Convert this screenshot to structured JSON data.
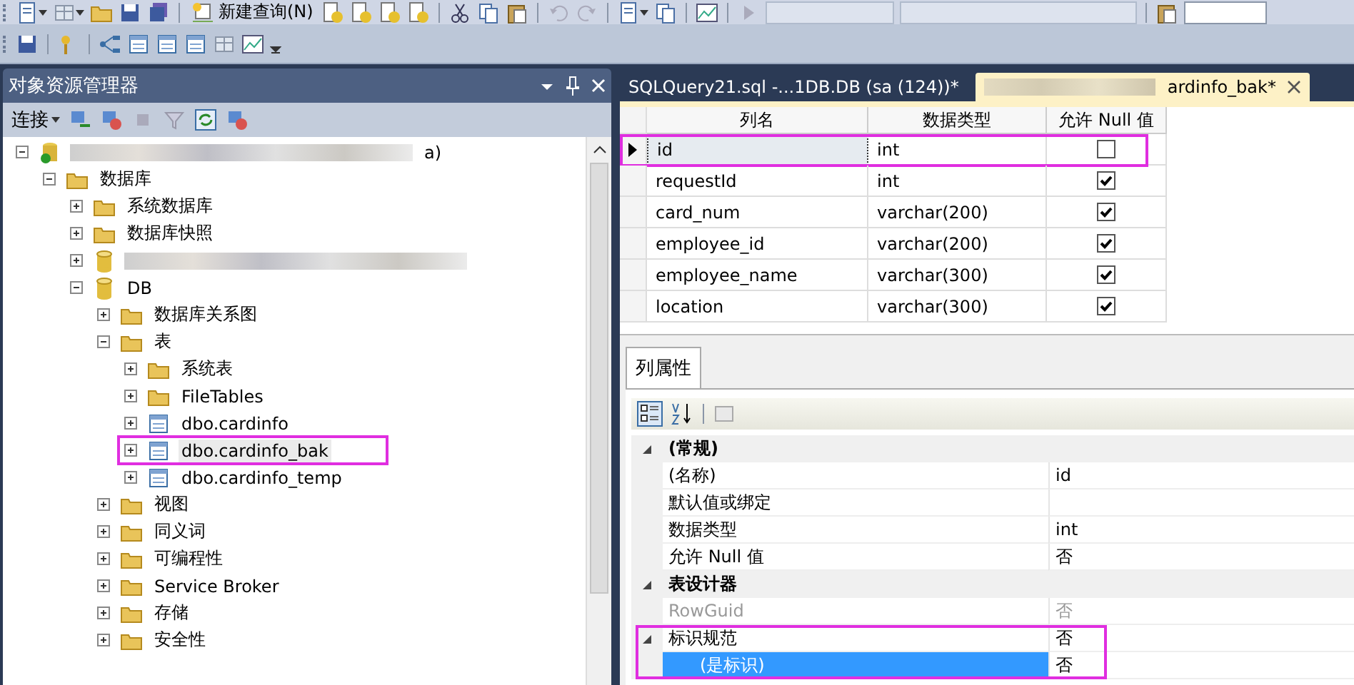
{
  "toolbar": {
    "new_query": "新建查询(N)"
  },
  "object_explorer": {
    "title": "对象资源管理器",
    "connect": "连接",
    "tree": [
      {
        "label": "a)",
        "kind": "server",
        "redacted": true,
        "expanded": true,
        "highlighted": false,
        "children": [
          {
            "label": "数据库",
            "kind": "folder",
            "expanded": true,
            "highlighted": false,
            "children": [
              {
                "label": "系统数据库",
                "kind": "folder",
                "expanded": false,
                "highlighted": false
              },
              {
                "label": "数据库快照",
                "kind": "folder",
                "expanded": false,
                "highlighted": false
              },
              {
                "kind": "database",
                "redacted": true,
                "expanded": false,
                "highlighted": false
              },
              {
                "label": "DB",
                "kind": "database",
                "expanded": true,
                "highlighted": false,
                "children": [
                  {
                    "label": "数据库关系图",
                    "kind": "folder",
                    "expanded": false,
                    "highlighted": false
                  },
                  {
                    "label": "表",
                    "kind": "folder",
                    "expanded": true,
                    "highlighted": false,
                    "children": [
                      {
                        "label": "系统表",
                        "kind": "folder",
                        "expanded": false,
                        "highlighted": false
                      },
                      {
                        "label": "FileTables",
                        "kind": "folder",
                        "expanded": false,
                        "highlighted": false
                      },
                      {
                        "label": "dbo.cardinfo",
                        "kind": "table",
                        "expanded": false,
                        "highlighted": false
                      },
                      {
                        "label": "dbo.cardinfo_bak",
                        "kind": "table",
                        "expanded": false,
                        "highlighted": true,
                        "selected": true
                      },
                      {
                        "label": "dbo.cardinfo_temp",
                        "kind": "table",
                        "expanded": false,
                        "highlighted": false
                      }
                    ]
                  },
                  {
                    "label": "视图",
                    "kind": "folder",
                    "expanded": false,
                    "highlighted": false
                  },
                  {
                    "label": "同义词",
                    "kind": "folder",
                    "expanded": false,
                    "highlighted": false
                  },
                  {
                    "label": "可编程性",
                    "kind": "folder",
                    "expanded": false,
                    "highlighted": false
                  },
                  {
                    "label": "Service Broker",
                    "kind": "folder",
                    "expanded": false,
                    "highlighted": false
                  },
                  {
                    "label": "存储",
                    "kind": "folder",
                    "expanded": false,
                    "highlighted": false
                  },
                  {
                    "label": "安全性",
                    "kind": "folder",
                    "expanded": false,
                    "highlighted": false
                  }
                ]
              }
            ]
          }
        ]
      }
    ]
  },
  "tabs": [
    {
      "label": "SQLQuery21.sql -...1DB.DB (sa (124))*",
      "selected": false,
      "redacted": false
    },
    {
      "label": "ardinfo_bak*",
      "selected": true,
      "redacted": true
    }
  ],
  "designer": {
    "columns": [
      "列名",
      "数据类型",
      "允许 Null 值"
    ],
    "rows": [
      {
        "name": "id",
        "type": "int",
        "allow_null": false,
        "selected": true,
        "highlighted": true
      },
      {
        "name": "requestId",
        "type": "int",
        "allow_null": true,
        "selected": false,
        "highlighted": false
      },
      {
        "name": "card_num",
        "type": "varchar(200)",
        "allow_null": true,
        "selected": false,
        "highlighted": false
      },
      {
        "name": "employee_id",
        "type": "varchar(200)",
        "allow_null": true,
        "selected": false,
        "highlighted": false
      },
      {
        "name": "employee_name",
        "type": "varchar(300)",
        "allow_null": true,
        "selected": false,
        "highlighted": false
      },
      {
        "name": "location",
        "type": "varchar(300)",
        "allow_null": true,
        "selected": false,
        "highlighted": false
      }
    ]
  },
  "properties": {
    "tab": "列属性",
    "rows": [
      {
        "kind": "category",
        "name": "(常规)",
        "expanded": true
      },
      {
        "kind": "property",
        "name": "(名称)",
        "value": "id",
        "disabled": false,
        "selected": false,
        "highlighted": false
      },
      {
        "kind": "property",
        "name": "默认值或绑定",
        "disabled": false,
        "selected": false,
        "highlighted": false
      },
      {
        "kind": "property",
        "name": "数据类型",
        "value": "int",
        "disabled": false,
        "selected": false,
        "highlighted": false
      },
      {
        "kind": "property",
        "name": "允许 Null 值",
        "value": "否",
        "disabled": false,
        "selected": false,
        "highlighted": false
      },
      {
        "kind": "category",
        "name": "表设计器",
        "expanded": true
      },
      {
        "kind": "property",
        "name": "RowGuid",
        "value": "否",
        "disabled": true,
        "selected": false,
        "highlighted": false
      },
      {
        "kind": "group",
        "name": "标识规范",
        "value": "否",
        "expanded": true,
        "disabled": false,
        "selected": false,
        "highlighted": true
      },
      {
        "kind": "subproperty",
        "name": "(是标识)",
        "value": "否",
        "disabled": false,
        "selected": true,
        "highlighted": true
      }
    ]
  }
}
